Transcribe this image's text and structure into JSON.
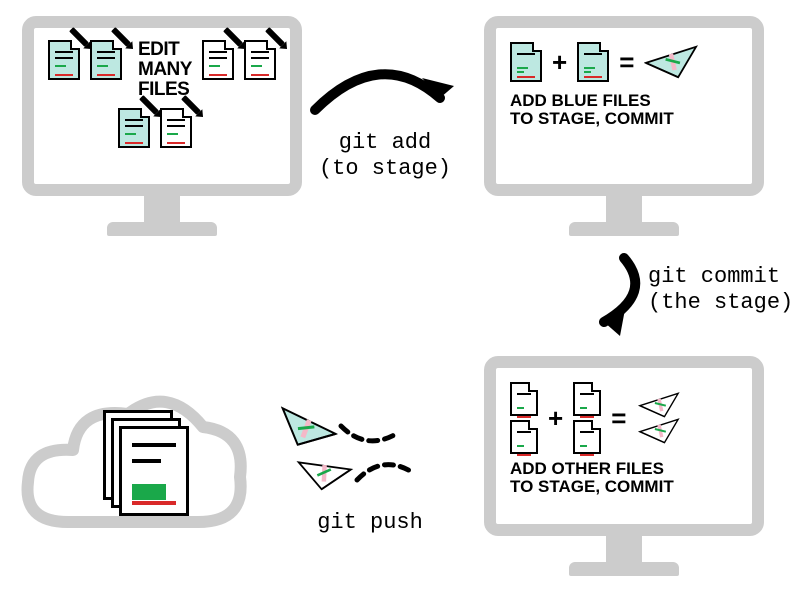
{
  "monitors": {
    "edit": {
      "title_line1": "EDIT",
      "title_line2": "MANY",
      "title_line3": "FILES"
    },
    "stage_blue": {
      "caption_line1": "ADD BLUE FILES",
      "caption_line2": "TO STAGE, COMMIT"
    },
    "stage_other": {
      "caption_line1": "ADD OTHER FILES",
      "caption_line2": "TO STAGE, COMMIT"
    }
  },
  "arrows": {
    "add": {
      "cmd": "git add",
      "note": "(to stage)"
    },
    "commit": {
      "cmd": "git commit",
      "note": "(the stage)"
    },
    "push": {
      "cmd": "git push"
    }
  },
  "symbols": {
    "plus": "+",
    "equals": "="
  },
  "colors": {
    "monitor_frame": "#cccccc",
    "file_blue": "#bde8e1",
    "line_green": "#1aa84a",
    "line_red": "#d92929",
    "plane_blue": "#bde8e1",
    "plane_pink": "#f4b8c8"
  },
  "icons": {
    "edited_file_blue": 3,
    "edited_file_white": 3,
    "cloud_file_stack": 3
  }
}
